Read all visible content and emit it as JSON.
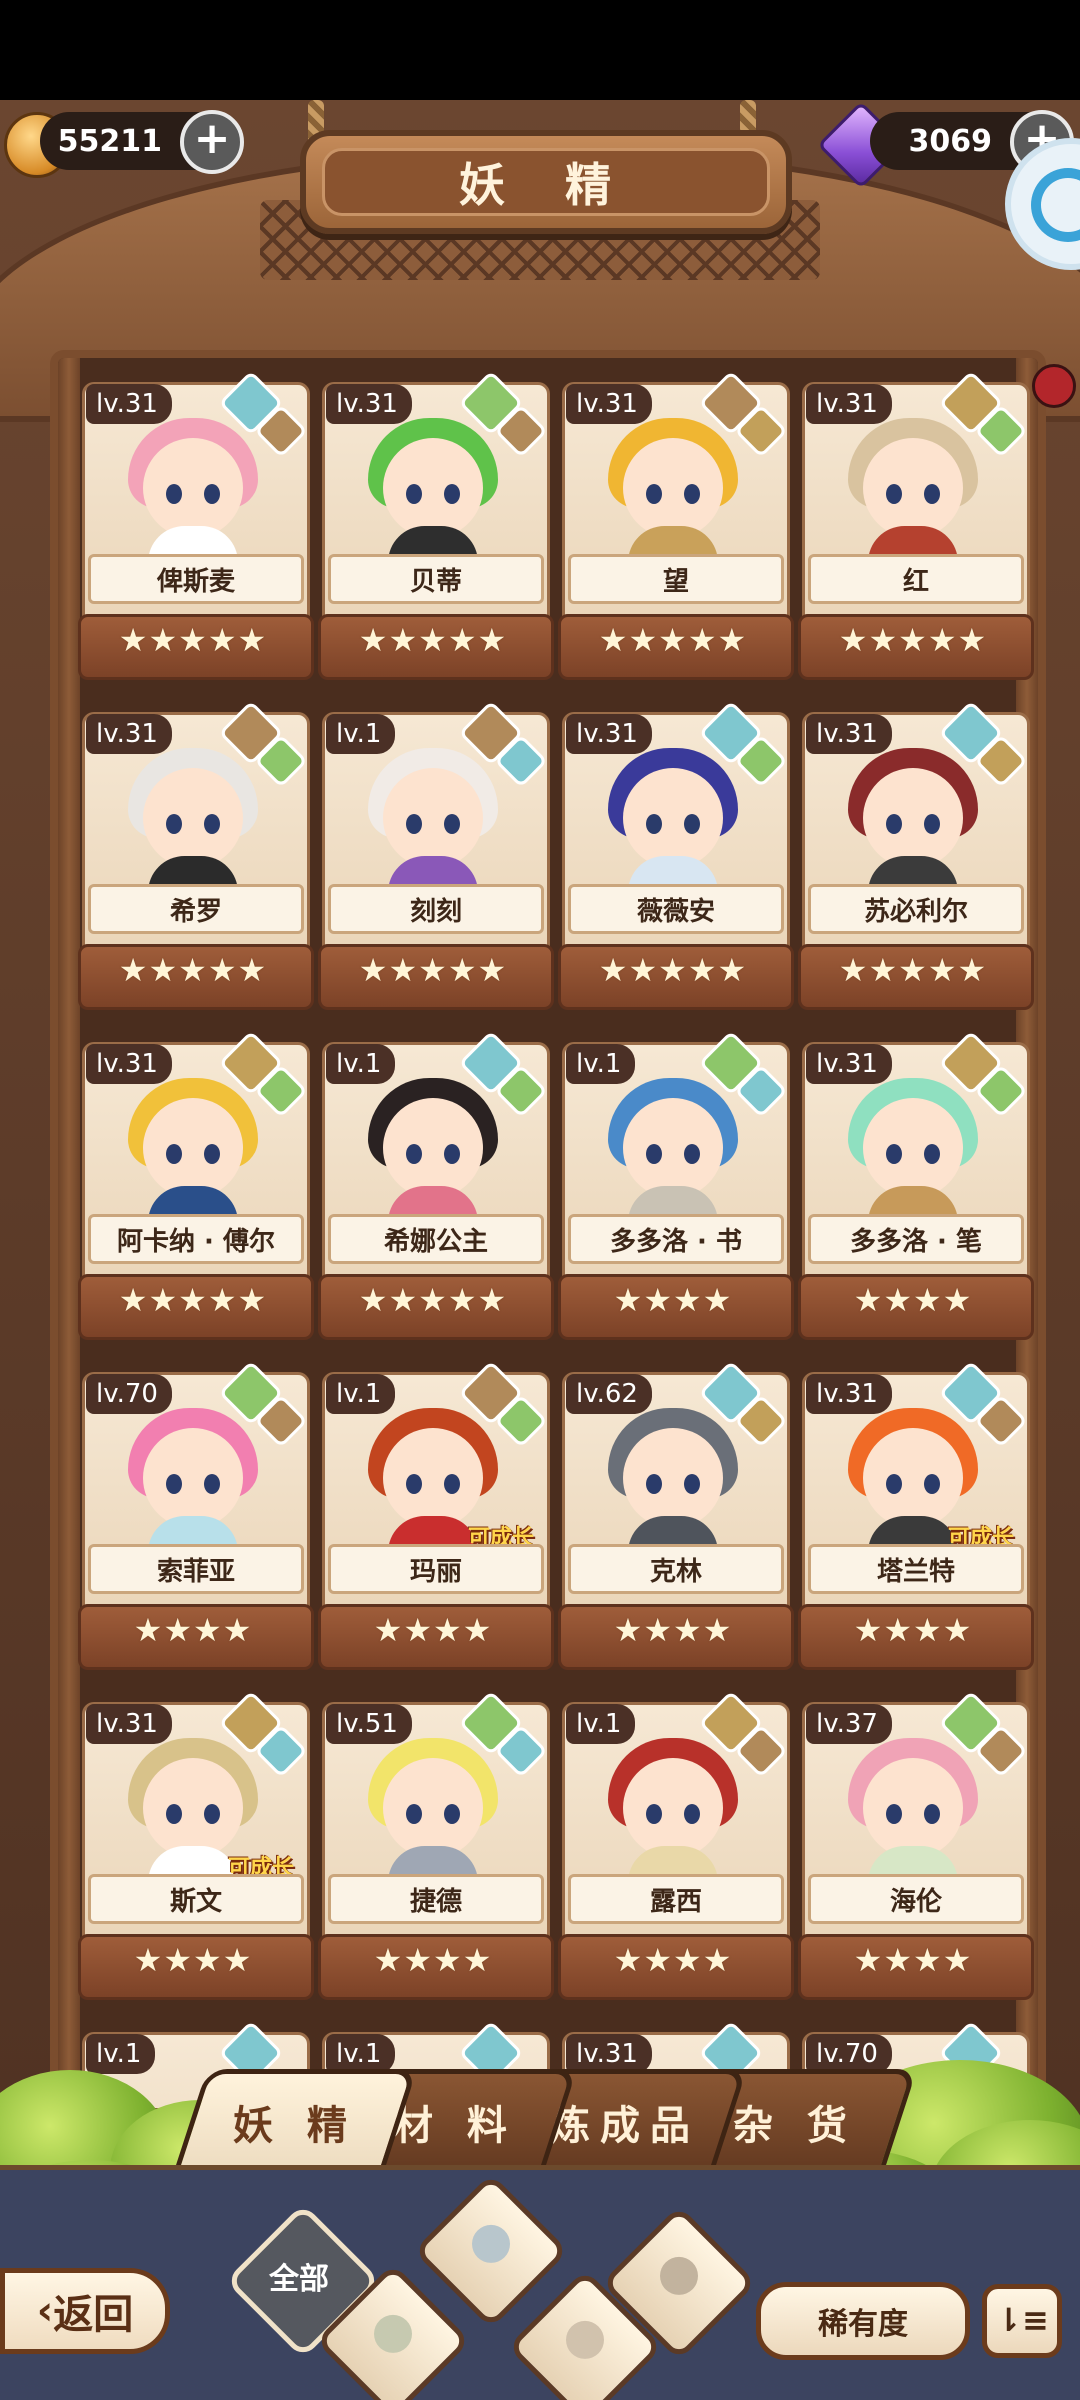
{
  "currency": {
    "gold": "55211",
    "gems": "3069"
  },
  "title": "妖 精",
  "cards": [
    {
      "level": "lv.31",
      "name": "俾斯麦",
      "stars": "★★★★★",
      "elems": [
        "water",
        "earth"
      ],
      "hair": "#f3a3b8",
      "body": "#ffffff",
      "grow": ""
    },
    {
      "level": "lv.31",
      "name": "贝蒂",
      "stars": "★★★★★",
      "elems": [
        "grass",
        "earth"
      ],
      "hair": "#5fc24a",
      "body": "#2e2e2e",
      "grow": ""
    },
    {
      "level": "lv.31",
      "name": "望",
      "stars": "★★★★★",
      "elems": [
        "earth",
        "rock"
      ],
      "hair": "#f0b632",
      "body": "#c9a15a",
      "grow": ""
    },
    {
      "level": "lv.31",
      "name": "红",
      "stars": "★★★★★",
      "elems": [
        "rock",
        "grass"
      ],
      "hair": "#d9c39f",
      "body": "#b5412f",
      "grow": ""
    },
    {
      "level": "lv.31",
      "name": "希罗",
      "stars": "★★★★★",
      "elems": [
        "earth",
        "grass"
      ],
      "hair": "#e9e6e2",
      "body": "#2b2b2b",
      "grow": ""
    },
    {
      "level": "lv.1",
      "name": "刻刻",
      "stars": "★★★★★",
      "elems": [
        "earth",
        "water"
      ],
      "hair": "#f1ebe6",
      "body": "#8a58b8",
      "grow": ""
    },
    {
      "level": "lv.31",
      "name": "薇薇安",
      "stars": "★★★★★",
      "elems": [
        "water",
        "grass"
      ],
      "hair": "#3a3a9a",
      "body": "#d8e6f2",
      "grow": ""
    },
    {
      "level": "lv.31",
      "name": "苏必利尔",
      "stars": "★★★★★",
      "elems": [
        "water",
        "rock"
      ],
      "hair": "#8a2b2b",
      "body": "#3b3b3b",
      "grow": ""
    },
    {
      "level": "lv.31",
      "name": "阿卡纳 · 傅尔",
      "stars": "★★★★★",
      "elems": [
        "rock",
        "grass"
      ],
      "hair": "#f1c13a",
      "body": "#2a4f8a",
      "grow": ""
    },
    {
      "level": "lv.1",
      "name": "希娜公主",
      "stars": "★★★★★",
      "elems": [
        "water",
        "grass"
      ],
      "hair": "#2a2222",
      "body": "#e2738a",
      "grow": ""
    },
    {
      "level": "lv.1",
      "name": "多多洛 · 书",
      "stars": "★★★★",
      "elems": [
        "grass",
        "water"
      ],
      "hair": "#4a8ac9",
      "body": "#c9c2b4",
      "grow": ""
    },
    {
      "level": "lv.31",
      "name": "多多洛 · 笔",
      "stars": "★★★★",
      "elems": [
        "rock",
        "grass"
      ],
      "hair": "#8fe0c0",
      "body": "#c79a5a",
      "grow": ""
    },
    {
      "level": "lv.70",
      "name": "索菲亚",
      "stars": "★★★★",
      "elems": [
        "grass",
        "earth"
      ],
      "hair": "#f27fb0",
      "body": "#b8e0ea",
      "grow": ""
    },
    {
      "level": "lv.1",
      "name": "玛丽",
      "stars": "★★★★",
      "elems": [
        "earth",
        "grass"
      ],
      "hair": "#c2451f",
      "body": "#c92e2e",
      "grow": "可成长"
    },
    {
      "level": "lv.62",
      "name": "克林",
      "stars": "★★★★",
      "elems": [
        "water",
        "rock"
      ],
      "hair": "#6a6f78",
      "body": "#4f545c",
      "grow": ""
    },
    {
      "level": "lv.31",
      "name": "塔兰特",
      "stars": "★★★★",
      "elems": [
        "water",
        "earth"
      ],
      "hair": "#f06a26",
      "body": "#3a3a3a",
      "grow": "可成长"
    },
    {
      "level": "lv.31",
      "name": "斯文",
      "stars": "★★★★",
      "elems": [
        "rock",
        "water"
      ],
      "hair": "#d8c28a",
      "body": "#ffffff",
      "grow": "可成长"
    },
    {
      "level": "lv.51",
      "name": "捷德",
      "stars": "★★★★",
      "elems": [
        "grass",
        "water"
      ],
      "hair": "#f2e46a",
      "body": "#9fa7b4",
      "grow": ""
    },
    {
      "level": "lv.1",
      "name": "露西",
      "stars": "★★★★",
      "elems": [
        "rock",
        "earth"
      ],
      "hair": "#b8312a",
      "body": "#e9d8a8",
      "grow": ""
    },
    {
      "level": "lv.37",
      "name": "海伦",
      "stars": "★★★★",
      "elems": [
        "grass",
        "earth"
      ],
      "hair": "#f0a3b6",
      "body": "#d7e7c6",
      "grow": ""
    }
  ],
  "partial_row_levels": [
    "lv.1",
    "lv.1",
    "lv.31",
    "lv.70"
  ],
  "tabs": [
    "妖 精",
    "材 料",
    "炼成品",
    "杂 货"
  ],
  "bottom": {
    "back": "返回",
    "all": "全部",
    "rarity": "稀有度",
    "sort_icon": "sort-icon"
  },
  "colors": {
    "water": "#7fc7cf",
    "grass": "#8dc66a",
    "earth": "#b18a5a",
    "rock": "#c2a05a",
    "accent": "#6b3b1c"
  }
}
